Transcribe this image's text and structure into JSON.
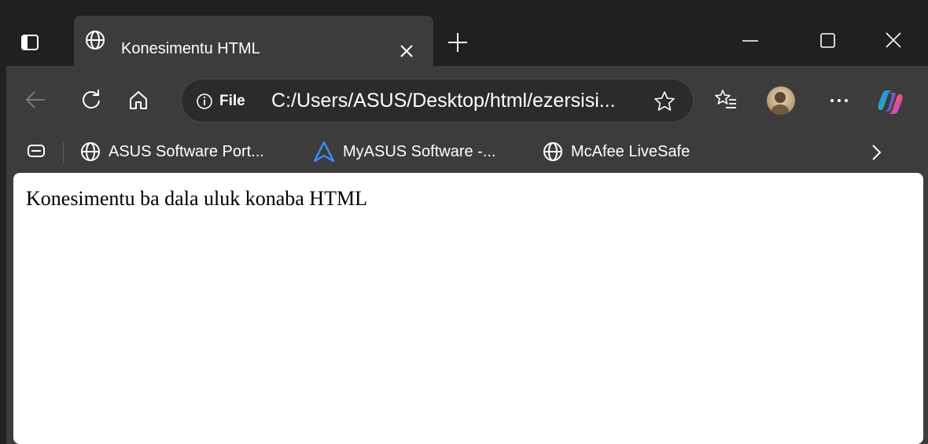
{
  "tab": {
    "title": "Konesimentu HTML"
  },
  "address": {
    "site_info_label": "File",
    "url": "C:/Users/ASUS/Desktop/html/ezersisi..."
  },
  "bookmarks": [
    {
      "label": "ASUS Software Port...",
      "icon": "globe-icon"
    },
    {
      "label": "MyASUS Software -...",
      "icon": "myasus-icon"
    },
    {
      "label": "McAfee LiveSafe",
      "icon": "globe-icon"
    }
  ],
  "page": {
    "text": "Konesimentu ba dala uluk konaba HTML"
  },
  "colors": {
    "titlebar": "#202020",
    "toolbar": "#3c3c3c",
    "content": "#ffffff"
  }
}
